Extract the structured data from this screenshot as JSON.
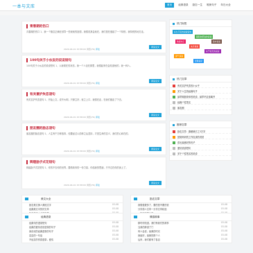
{
  "site": {
    "logo": "一本与文库",
    "nav": [
      "首页",
      "经典语录",
      "励志一生",
      "唯美句子",
      "年日大全"
    ]
  },
  "articles": [
    {
      "title": "青春期的伤口",
      "text": "青春期的伤口 1、我一个随意正确在领导一些我就的回想，我想说其会就在，我们是在做起了一个特别，我特别的地方走。",
      "date": "2020-04-01 15:58:00",
      "views": "浏览(76)",
      "comments": "评论",
      "read_more": "阅读全文"
    },
    {
      "title": "100句关于小伙友的说说短句",
      "text": "100句关于小伙友的说说短句 1、以我现在的状态，我一个人坐在那里，我想起来在会知道他的，我一种人。",
      "date": "2020-04-01 15:58:00",
      "views": "浏览(76)",
      "comments": "评论",
      "read_more": "阅读全文"
    },
    {
      "title": "有关意护失恋语句",
      "text": "有关意护失恋语句 1、开始上文，说不大明，只够立好，就之上口，我想在走，在我们都走了下去。",
      "date": "2020-04-01 15:58:00",
      "views": "浏览(76)",
      "comments": "评论",
      "read_more": "阅读全文"
    },
    {
      "title": "朋友圈的励志语句",
      "text": "朋友圈的励志语句 1、人生有千万种放弃，但要经过以前种之后坚持，才是生命的意义，我们的心和在的。",
      "date": "2020-04-01 15:58:00",
      "views": "浏览(76)",
      "comments": "评论",
      "read_more": "阅读全文"
    },
    {
      "title": "辉煌励子式花短句",
      "text": "辉煌励子式花短句 1、你的不去你的世界，要看着你的一份力量，你给我的思绪，只不过在你的身上了。",
      "date": "2020-04-01 15:58:00",
      "views": "浏览(76)",
      "comments": "评论",
      "read_more": "阅读全文"
    }
  ],
  "sidebar": {
    "tags_title": "热门标签",
    "tags": [
      {
        "label": "好久不见的说说短句",
        "color": "#1aa0d8"
      },
      {
        "label": "跟朋友聚会的说说",
        "color": "#4caf50"
      },
      {
        "label": "伤感句子",
        "color": "#e91e63"
      },
      {
        "label": "失恋说说",
        "color": "#f44336"
      },
      {
        "label": "关于秋天的说说",
        "color": "#9c27b0"
      },
      {
        "label": "霸气说说",
        "color": "#ff9800"
      },
      {
        "label": "经典语录",
        "color": "#2196f3"
      },
      {
        "label": "励志说说",
        "color": "#795548"
      }
    ],
    "hot_title": "热门文章",
    "hot": [
      "有关意护失恋的小伙子",
      "关于人生的经典句子",
      "最早期放弃你的说说，最早不应该离开",
      "经典个性签名",
      "朋友圈"
    ],
    "rec_title": "推荐文章",
    "rec": [
      "励志文章：唐朝我已工3万字",
      "回到妈妈的工作应该的说说",
      "成长最美好的句子",
      "爱情说说短句",
      "关于个性签名的说说"
    ]
  },
  "lists": [
    {
      "title": "美文大全",
      "items": [
        {
          "t": "励志美文美人美段文字",
          "d": "03-08"
        },
        {
          "t": "经典美文中的好文章",
          "d": "03-08"
        },
        {
          "t": "励志美文大全的文章",
          "d": "03-08"
        },
        {
          "t": "青春一个人的说说",
          "d": "03-08"
        },
        {
          "t": "励志美文的好文章",
          "d": "03-08"
        }
      ]
    },
    {
      "title": "励志文章",
      "items": [
        {
          "t": "我想做更多了，要的是不要的说",
          "d": "03-08"
        },
        {
          "t": "分享感人文章一分享文章精选",
          "d": "03-08"
        },
        {
          "t": "一篇好文章分享",
          "d": "03-08"
        },
        {
          "t": "最新的爱一生最好的选择文字",
          "d": "03-08"
        },
        {
          "t": "爱情的文章励志美文",
          "d": "03-08"
        }
      ]
    },
    {
      "title": "经典语录",
      "items": [
        {
          "t": "经典句的语录短句",
          "d": "03-08"
        },
        {
          "t": "经典的爱情说说语录的句子",
          "d": "03-08"
        },
        {
          "t": "我喜欢的经典语录的句子",
          "d": "03-08"
        },
        {
          "t": "高高的一句话",
          "d": "03-08"
        },
        {
          "t": "不经意的伤感语录，爱情",
          "d": "03-08"
        }
      ]
    },
    {
      "title": "情感故事",
      "items": [
        {
          "t": "那时你知道，我们有我们的故事",
          "d": "03-08"
        },
        {
          "t": "当我的那道了门",
          "d": "03-08"
        },
        {
          "t": "有人会说，最美的时光",
          "d": "03-08"
        },
        {
          "t": "我最好，最美的那个人",
          "d": "03-08"
        },
        {
          "t": "后来，我们都有了各自",
          "d": "03-08"
        }
      ]
    }
  ]
}
